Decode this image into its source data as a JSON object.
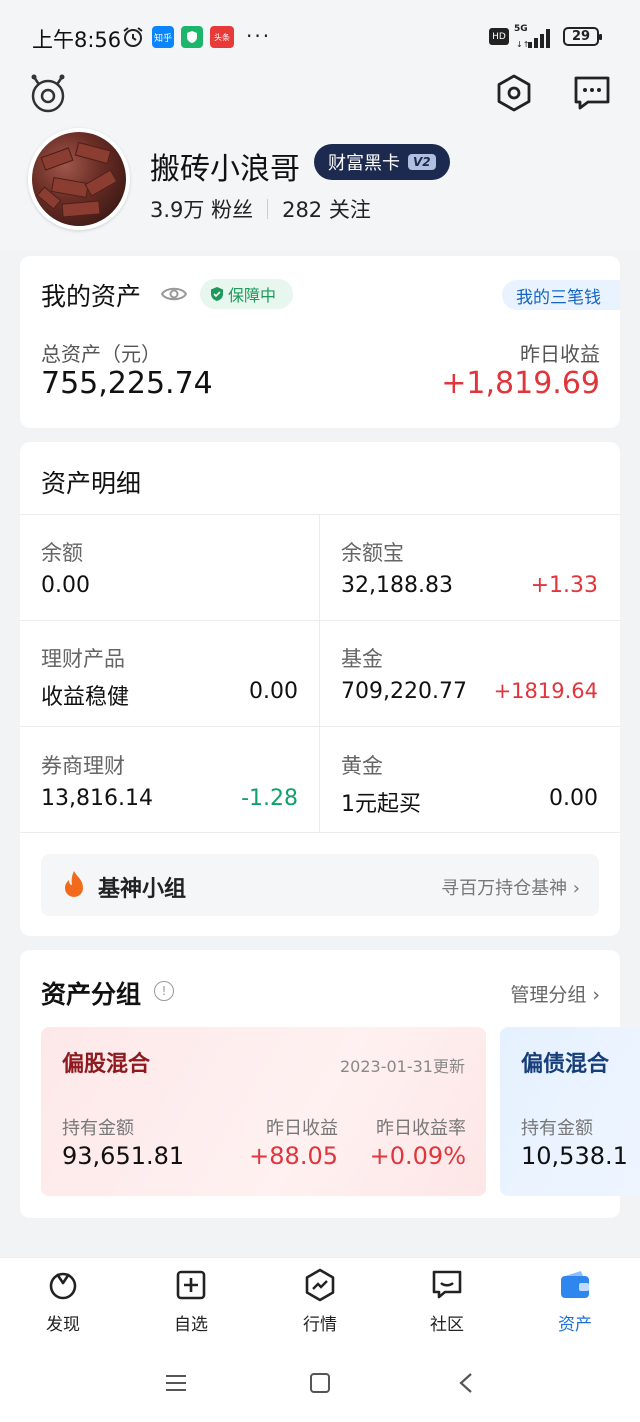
{
  "status_bar": {
    "time": "上午8:56",
    "app_icons": [
      "知乎",
      "shield",
      "头条"
    ],
    "more": "···",
    "hd": "HD",
    "network": "5G",
    "battery": "29"
  },
  "header": {
    "username": "搬砖小浪哥",
    "badge": "财富黑卡",
    "badge_level": "V2",
    "fans": "3.9万 粉丝",
    "following": "282 关注"
  },
  "my_assets": {
    "title": "我的资产",
    "guard_label": "保障中",
    "three_money": "我的三笔钱",
    "total_label": "总资产（元）",
    "total_value": "755,225.74",
    "yesterday_label": "昨日收益",
    "yesterday_value": "+1,819.69"
  },
  "asset_detail": {
    "title": "资产明细",
    "cells": [
      {
        "label": "余额",
        "value": "0.00",
        "gain": ""
      },
      {
        "label": "余额宝",
        "value": "32,188.83",
        "gain": "+1.33"
      },
      {
        "label": "理财产品",
        "value": "收益稳健",
        "gain": "0.00"
      },
      {
        "label": "基金",
        "value": "709,220.77",
        "gain": "+1819.64"
      },
      {
        "label": "券商理财",
        "value": "13,816.14",
        "gain": "-1.28"
      },
      {
        "label": "黄金",
        "value": "1元起买",
        "gain": "0.00"
      }
    ]
  },
  "jishen": {
    "label": "基神小组",
    "link": "寻百万持仓基神 ›"
  },
  "asset_groups": {
    "title": "资产分组",
    "info": "!",
    "manage": "管理分组 ›",
    "groups": [
      {
        "name": "偏股混合",
        "updated": "2023-01-31更新",
        "hold_label": "持有金额",
        "hold_value": "93,651.81",
        "yest_label": "昨日收益",
        "yest_value": "+88.05",
        "rate_label": "昨日收益率",
        "rate_value": "+0.09%"
      },
      {
        "name": "偏债混合",
        "hold_label": "持有金额",
        "hold_value": "10,538.1"
      }
    ]
  },
  "bottom_nav": [
    {
      "label": "发现",
      "icon": "discover-icon"
    },
    {
      "label": "自选",
      "icon": "watchlist-icon"
    },
    {
      "label": "行情",
      "icon": "market-icon"
    },
    {
      "label": "社区",
      "icon": "community-icon"
    },
    {
      "label": "资产",
      "icon": "wallet-icon",
      "active": true
    }
  ],
  "colors": {
    "up": "#e0353b",
    "down": "#12a06b",
    "accent": "#1e6fd9"
  }
}
